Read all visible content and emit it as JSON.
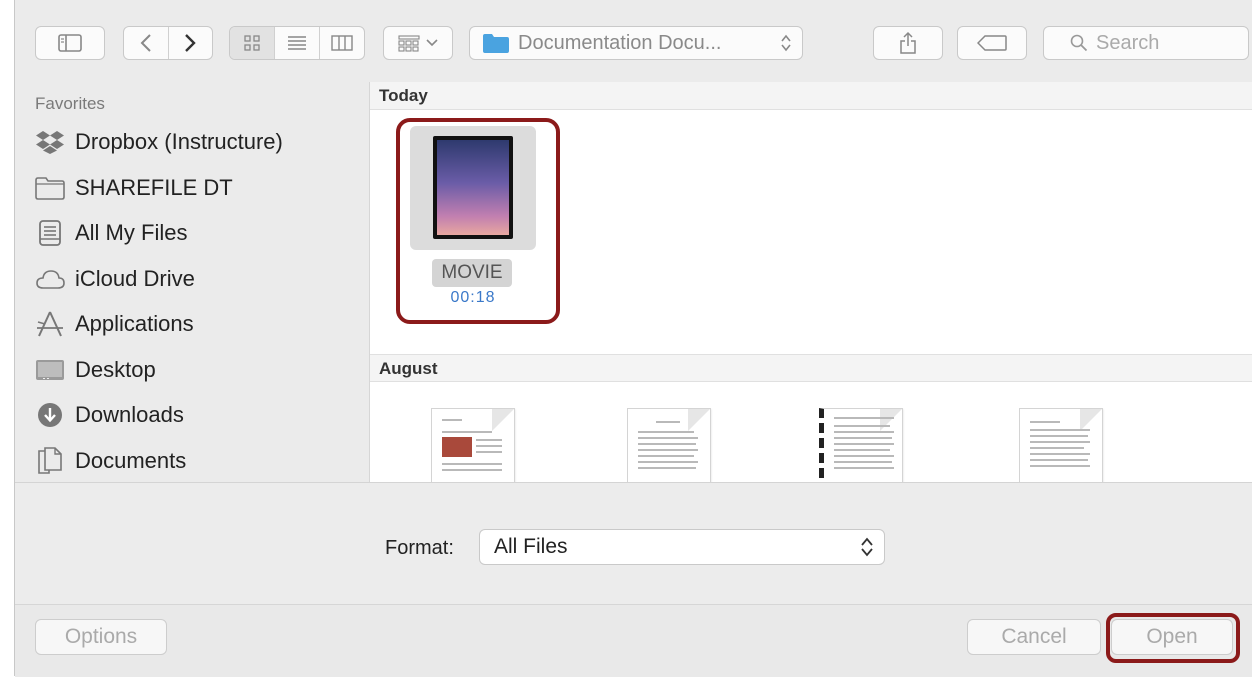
{
  "toolbar": {
    "path": "Documentation Docu...",
    "search_placeholder": "Search"
  },
  "sidebar": {
    "heading": "Favorites",
    "items": [
      {
        "label": "Dropbox (Instructure)",
        "icon": "dropbox-icon"
      },
      {
        "label": "SHAREFILE DT",
        "icon": "folder-icon"
      },
      {
        "label": "All My Files",
        "icon": "all-files-icon"
      },
      {
        "label": "iCloud Drive",
        "icon": "cloud-icon"
      },
      {
        "label": "Applications",
        "icon": "applications-icon"
      },
      {
        "label": "Desktop",
        "icon": "desktop-icon"
      },
      {
        "label": "Downloads",
        "icon": "downloads-icon"
      },
      {
        "label": "Documents",
        "icon": "documents-icon"
      }
    ]
  },
  "content": {
    "sections": [
      {
        "title": "Today"
      },
      {
        "title": "August"
      }
    ],
    "today_item": {
      "name": "MOVIE",
      "duration": "00:18"
    }
  },
  "format": {
    "label": "Format:",
    "value": "All Files"
  },
  "buttons": {
    "options": "Options",
    "cancel": "Cancel",
    "open": "Open"
  },
  "colors": {
    "highlight": "#8b1a1a",
    "folder_blue": "#4aa3e0",
    "duration_blue": "#3b79c9"
  }
}
